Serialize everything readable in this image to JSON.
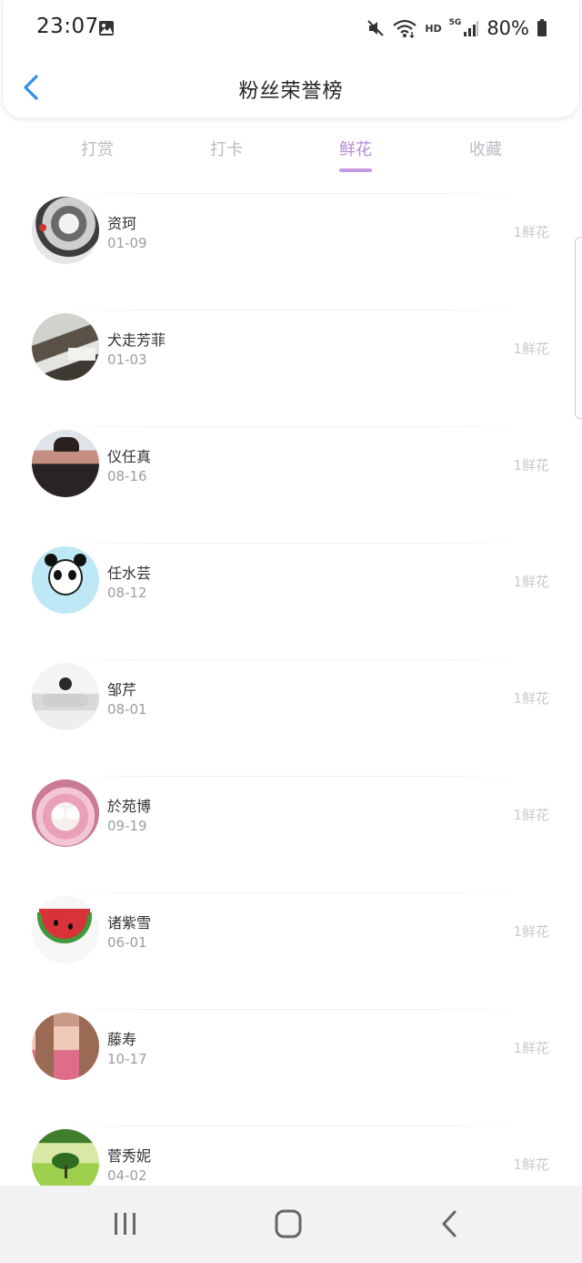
{
  "status_bar": {
    "time": "23:07",
    "battery": "80%",
    "network_hd": "HD",
    "network_5g": "5G",
    "icons": [
      "image-icon",
      "mute-icon",
      "wifi-icon",
      "signal-icon",
      "battery-icon"
    ]
  },
  "header": {
    "title": "粉丝荣誉榜",
    "back_icon": "chevron-left-icon"
  },
  "tabs": [
    {
      "label": "打赏",
      "active": false
    },
    {
      "label": "打卡",
      "active": false
    },
    {
      "label": "鲜花",
      "active": true
    },
    {
      "label": "收藏",
      "active": false
    }
  ],
  "accent_color": "#b58ad6",
  "fans": [
    {
      "name": "资珂",
      "date": "01-09",
      "amount": "1鲜花"
    },
    {
      "name": "犬走芳菲",
      "date": "01-03",
      "amount": "1鲜花"
    },
    {
      "name": "仪任真",
      "date": "08-16",
      "amount": "1鲜花"
    },
    {
      "name": "任水芸",
      "date": "08-12",
      "amount": "1鲜花"
    },
    {
      "name": "邹芹",
      "date": "08-01",
      "amount": "1鲜花"
    },
    {
      "name": "於苑博",
      "date": "09-19",
      "amount": "1鲜花"
    },
    {
      "name": "诸紫雪",
      "date": "06-01",
      "amount": "1鲜花"
    },
    {
      "name": "藤寿",
      "date": "10-17",
      "amount": "1鲜花"
    },
    {
      "name": "菅秀妮",
      "date": "04-02",
      "amount": "1鲜花"
    }
  ],
  "system_nav": {
    "icons": [
      "recents-icon",
      "home-icon",
      "back-icon"
    ]
  }
}
